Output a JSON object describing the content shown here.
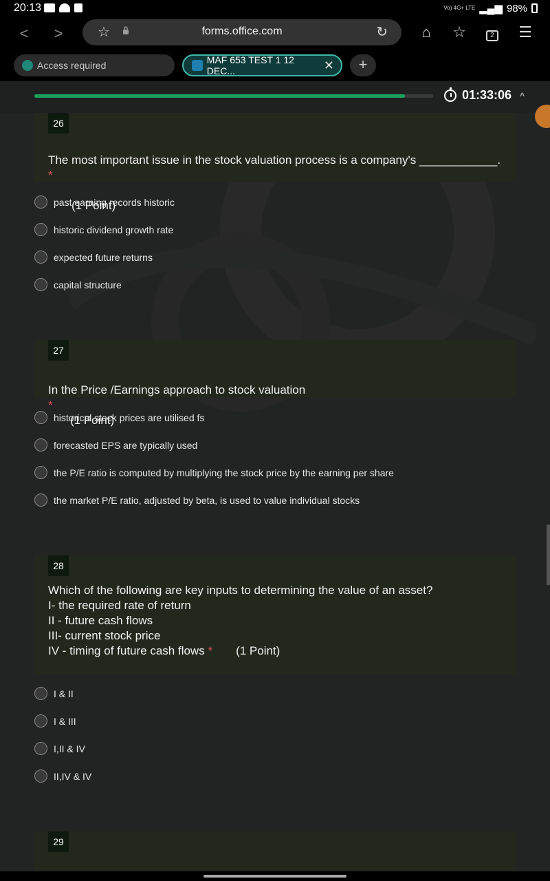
{
  "status_bar": {
    "time": "20:13",
    "network": "Vo) 4G+ LTE",
    "battery": "98%"
  },
  "browser": {
    "url": "forms.office.com",
    "tab_count": "2",
    "icons": [
      "back-icon",
      "forward-icon",
      "star-icon",
      "lock-icon",
      "reload-icon",
      "home-icon",
      "bookmarks-icon",
      "tabs-icon",
      "menu-icon"
    ]
  },
  "tabs": [
    {
      "label": "Access required",
      "favicon": "sharepoint-icon"
    },
    {
      "label": "MAF 653 TEST 1 12 DEC...",
      "favicon": "forms-icon",
      "active": true
    }
  ],
  "form": {
    "progress_fraction": 0.93,
    "timer": "01:33:06",
    "accent_color": "#19a35b",
    "questions": [
      {
        "number": "26",
        "text": "The most important issue in the stock valuation process is a company's ____________.",
        "required": "*",
        "points": "(1 Point)",
        "options": [
          "past earning records historic",
          "historic dividend growth rate",
          "expected future returns",
          "capital structure"
        ]
      },
      {
        "number": "27",
        "text": "In the Price /Earnings approach to stock valuation",
        "required": "*",
        "points": "(1 Point)",
        "options": [
          "historical stock prices are utilised fs",
          "forecasted EPS are typically used",
          "the P/E ratio is computed by multiplying the stock price by the earning per share",
          "the market P/E ratio, adjusted by beta, is used to value individual stocks"
        ]
      },
      {
        "number": "28",
        "text": "Which of the following are key inputs to determining the value of an asset?\n I- the required rate of return\nII - future cash flows\nIII- current stock price\nIV - timing of future cash flows",
        "required": "*",
        "points": "(1 Point)",
        "options": [
          "I & II",
          "I & III",
          "I,II & IV",
          "II,IV & IV"
        ]
      },
      {
        "number": "29"
      }
    ]
  }
}
